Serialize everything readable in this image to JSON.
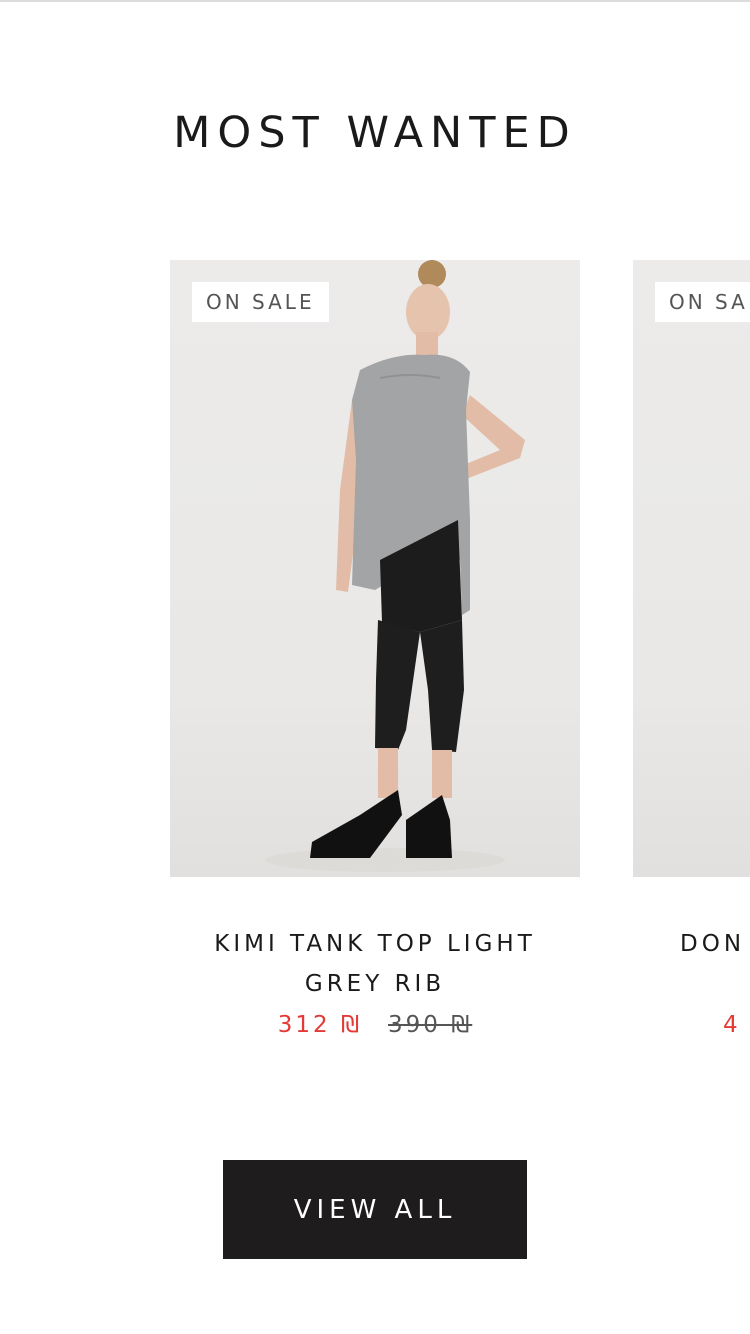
{
  "section": {
    "title": "MOST WANTED"
  },
  "products": [
    {
      "badge": "ON SALE",
      "title_line1": "KIMI TANK TOP LIGHT",
      "title_line2": "GREY RIB",
      "price_sale": "312 ₪",
      "price_old": "390 ₪"
    },
    {
      "badge": "ON SA",
      "title_line1": "DON",
      "price_sale": "4"
    }
  ],
  "actions": {
    "view_all": "VIEW ALL"
  },
  "colors": {
    "sale": "#e53935",
    "button_bg": "#1e1c1c",
    "text": "#1a1a1a"
  }
}
